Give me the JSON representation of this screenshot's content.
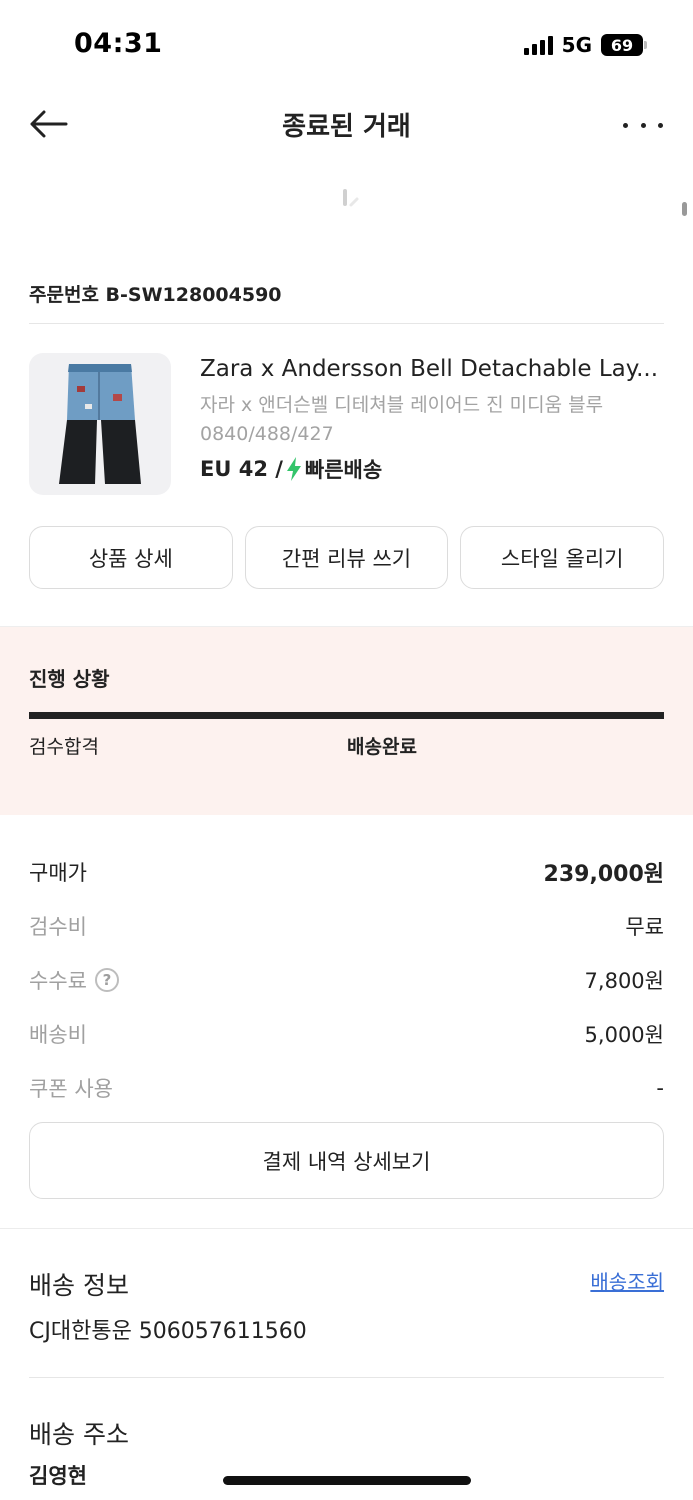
{
  "status_bar": {
    "time": "04:31",
    "network": "5G",
    "battery": "69"
  },
  "header": {
    "title": "종료된 거래"
  },
  "order": {
    "label": "주문번호 B-SW128004590"
  },
  "product": {
    "name": "Zara x Andersson Bell Detachable Lay...",
    "name_ko": "자라 x 앤더슨벨 디테쳐블 레이어드 진 미디움 블루",
    "code": "0840/488/427",
    "size": "EU 42 /",
    "delivery": "빠른배송"
  },
  "actions": [
    {
      "label": "상품 상세"
    },
    {
      "label": "간편 리뷰 쓰기"
    },
    {
      "label": "스타일 올리기"
    }
  ],
  "progress": {
    "title": "진행 상황",
    "steps": [
      "검수합격",
      "배송완료"
    ],
    "completion": 1.0
  },
  "payment": {
    "rows": [
      {
        "label": "구매가",
        "value": "239,000원"
      },
      {
        "label": "검수비",
        "value": "무료"
      },
      {
        "label": "수수료",
        "value": "7,800원"
      },
      {
        "label": "배송비",
        "value": "5,000원"
      },
      {
        "label": "쿠폰 사용",
        "value": "-"
      }
    ],
    "help_glyph": "?",
    "detail_button": "결제 내역 상세보기"
  },
  "shipping": {
    "title": "배송 정보",
    "track_link": "배송조회",
    "carrier": "CJ대한통운 506057611560"
  },
  "address": {
    "title": "배송 주소",
    "name": "김영현"
  },
  "colors": {
    "accent_link": "#3a6fd6",
    "progress_bg": "#fdf2ef",
    "fast_delivery": "#33c46a"
  },
  "icons": [
    "back-arrow-icon",
    "more-icon",
    "loading-spinner-icon",
    "lightning-icon",
    "help-icon"
  ]
}
